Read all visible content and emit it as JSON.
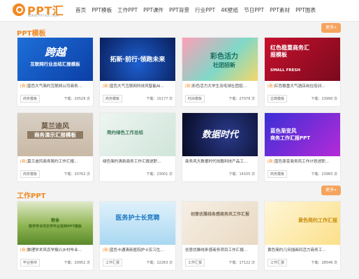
{
  "logo": {
    "text": "PPT汇",
    "sub": "WWW.PPTHUI.COM"
  },
  "nav": [
    "首页",
    "PPT模板",
    "工作PPT",
    "PPT课件",
    "PPT背景",
    "行业PPT",
    "4K壁纸",
    "节日PPT",
    "PPT素材",
    "PPT图表"
  ],
  "sections": [
    {
      "title": "PPT模板",
      "more": "更多»",
      "cards": [
        {
          "thumb_text": "跨越",
          "thumb_sub": "互联网行业总结汇报模板",
          "badge": "[新]",
          "title": "蓝色大气简约互联网公司商务...",
          "tag": "商务模板",
          "downloads_label": "下载：",
          "downloads": "20529",
          "unit": "次"
        },
        {
          "thumb_text": "拓新·前行·领跑未来",
          "thumb_sub": "",
          "badge": "[新]",
          "title": "蓝色大气互联网科技风智能AI...",
          "tag": "商务模板",
          "downloads_label": "下载：",
          "downloads": "15177",
          "unit": "次"
        },
        {
          "thumb_text": "彩色活力",
          "thumb_sub": "社团招新",
          "badge": "[新]",
          "title": "彩色活力大学生羽毛球社团招...",
          "tag": "时尚模板",
          "downloads_label": "下载：",
          "downloads": "27078",
          "unit": "次"
        },
        {
          "thumb_text": "红色稳重商务汇报模板",
          "thumb_sub": "SMALL FRESH",
          "badge": "[新]",
          "title": "红色稳重大气酒店岗位培训...",
          "tag": "古典模板",
          "downloads_label": "下载：",
          "downloads": "23990",
          "unit": "次"
        },
        {
          "thumb_text": "莫兰迪风",
          "thumb_sub": "商务演示汇报模板",
          "badge": "[新]",
          "title": "莫兰迪风商务简约工作汇报...",
          "tag": "商务模板",
          "downloads_label": "下载：",
          "downloads": "20762",
          "unit": "次"
        },
        {
          "thumb_text": "简约绿色工作总结",
          "thumb_sub": "",
          "badge": "",
          "title": "绿色简约清新商务工作汇报述职...",
          "tag": "",
          "downloads_label": "下载：",
          "downloads": "23001",
          "unit": "次"
        },
        {
          "thumb_text": "数据时代",
          "thumb_sub": "",
          "badge": "",
          "title": "商务风大数据时代炫酷科技产品工...",
          "tag": "",
          "downloads_label": "下载：",
          "downloads": "14105",
          "unit": "次"
        },
        {
          "thumb_text": "蓝色渐变风",
          "thumb_sub": "商务工作汇报PPT",
          "badge": "[新]",
          "title": "蓝色渐变商务风工作计划述职...",
          "tag": "商务模板",
          "downloads_label": "下载：",
          "downloads": "23965",
          "unit": "次"
        }
      ]
    },
    {
      "title": "工作PPT",
      "more": "更多»",
      "cards": [
        {
          "thumb_text": "粮食",
          "thumb_sub": "数学学术风农学毕业答辩PPT模板",
          "badge": "[新]",
          "title": "数理学术风农学振兴乡村毕业...",
          "tag": "毕业答辩",
          "downloads_label": "下载：",
          "downloads": "20952",
          "unit": "次"
        },
        {
          "thumb_text": "医务护士长竞聘",
          "thumb_sub": "",
          "badge": "[新]",
          "title": "蓝色卡通清新医院护士实习生...",
          "tag": "工作汇报",
          "downloads_label": "下载：",
          "downloads": "22263",
          "unit": "次"
        },
        {
          "thumb_text": "创意优雅线条感商务风工作汇报",
          "thumb_sub": "",
          "badge": "",
          "title": "创意优雅线条感商务项目工作汇报...",
          "tag": "工作汇报",
          "downloads_label": "下载：",
          "downloads": "17122",
          "unit": "次"
        },
        {
          "thumb_text": "黄色简约工作汇报",
          "thumb_sub": "",
          "badge": "",
          "title": "黄色简约几何插画风活力商务工...",
          "tag": "工作汇报",
          "downloads_label": "下载：",
          "downloads": "28546",
          "unit": "次"
        }
      ]
    }
  ],
  "colors": {
    "accent": "#f08a24",
    "button": "#f5a45d",
    "bg": "#f3f3f3"
  }
}
